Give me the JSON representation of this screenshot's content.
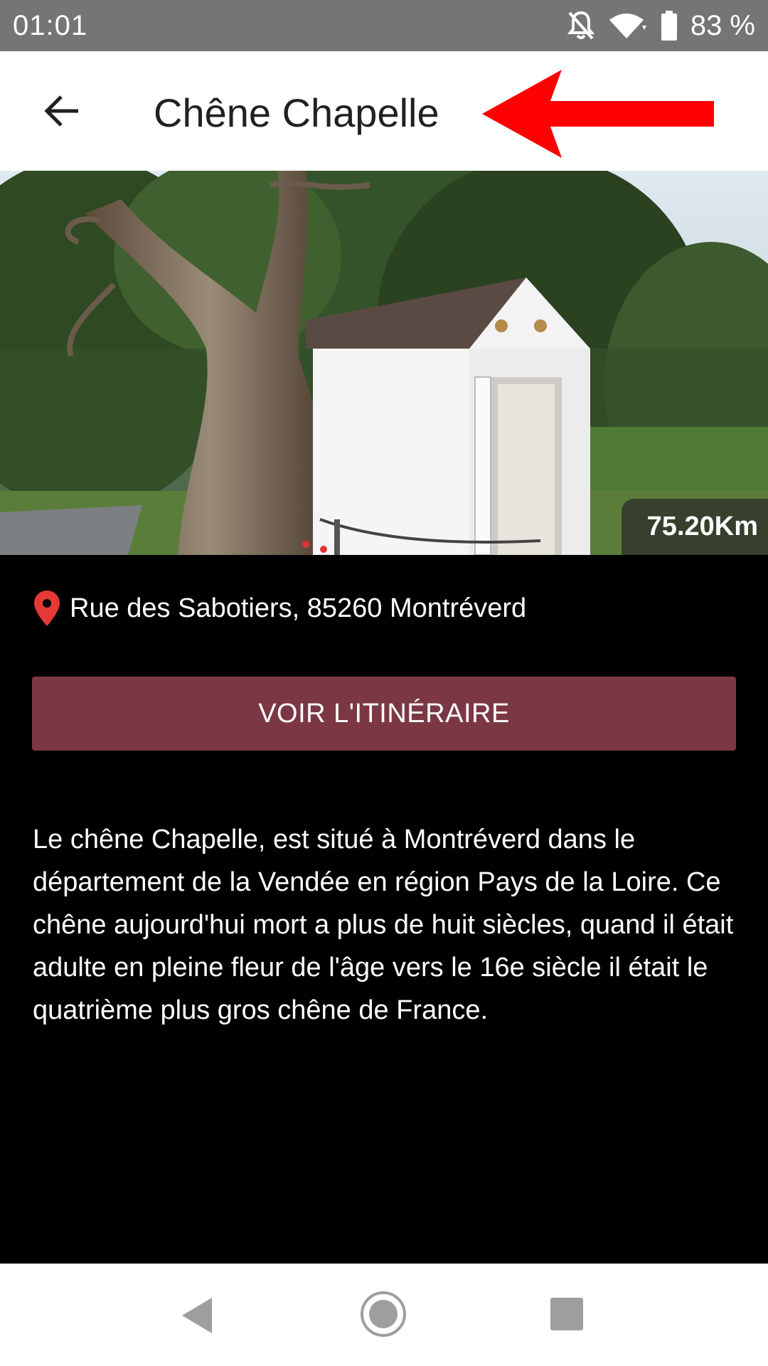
{
  "status_bar": {
    "time": "01:01",
    "battery": "83 %",
    "icons": [
      "notifications-off-icon",
      "wifi-icon",
      "battery-icon"
    ]
  },
  "app_bar": {
    "title": "Chêne Chapelle",
    "back_icon": "arrow-back-icon",
    "annotation_icon": "red-arrow-icon"
  },
  "hero": {
    "distance": "75.20Km"
  },
  "place": {
    "address": "Rue des Sabotiers, 85260 Montréverd",
    "pin_color": "#e53935"
  },
  "actions": {
    "route_label": "VOIR L'ITINÉRAIRE",
    "route_color": "#7b3844"
  },
  "description": "Le chêne Chapelle, est situé à Montréverd dans le département de la Vendée en région Pays de la Loire. Ce chêne aujourd'hui mort a plus de huit siècles, quand il était adulte en pleine fleur de l'âge vers le 16e siècle il était le quatrième plus gros chêne de France.",
  "nav_bar": {
    "icons": [
      "nav-back-icon",
      "nav-home-icon",
      "nav-recents-icon"
    ]
  }
}
